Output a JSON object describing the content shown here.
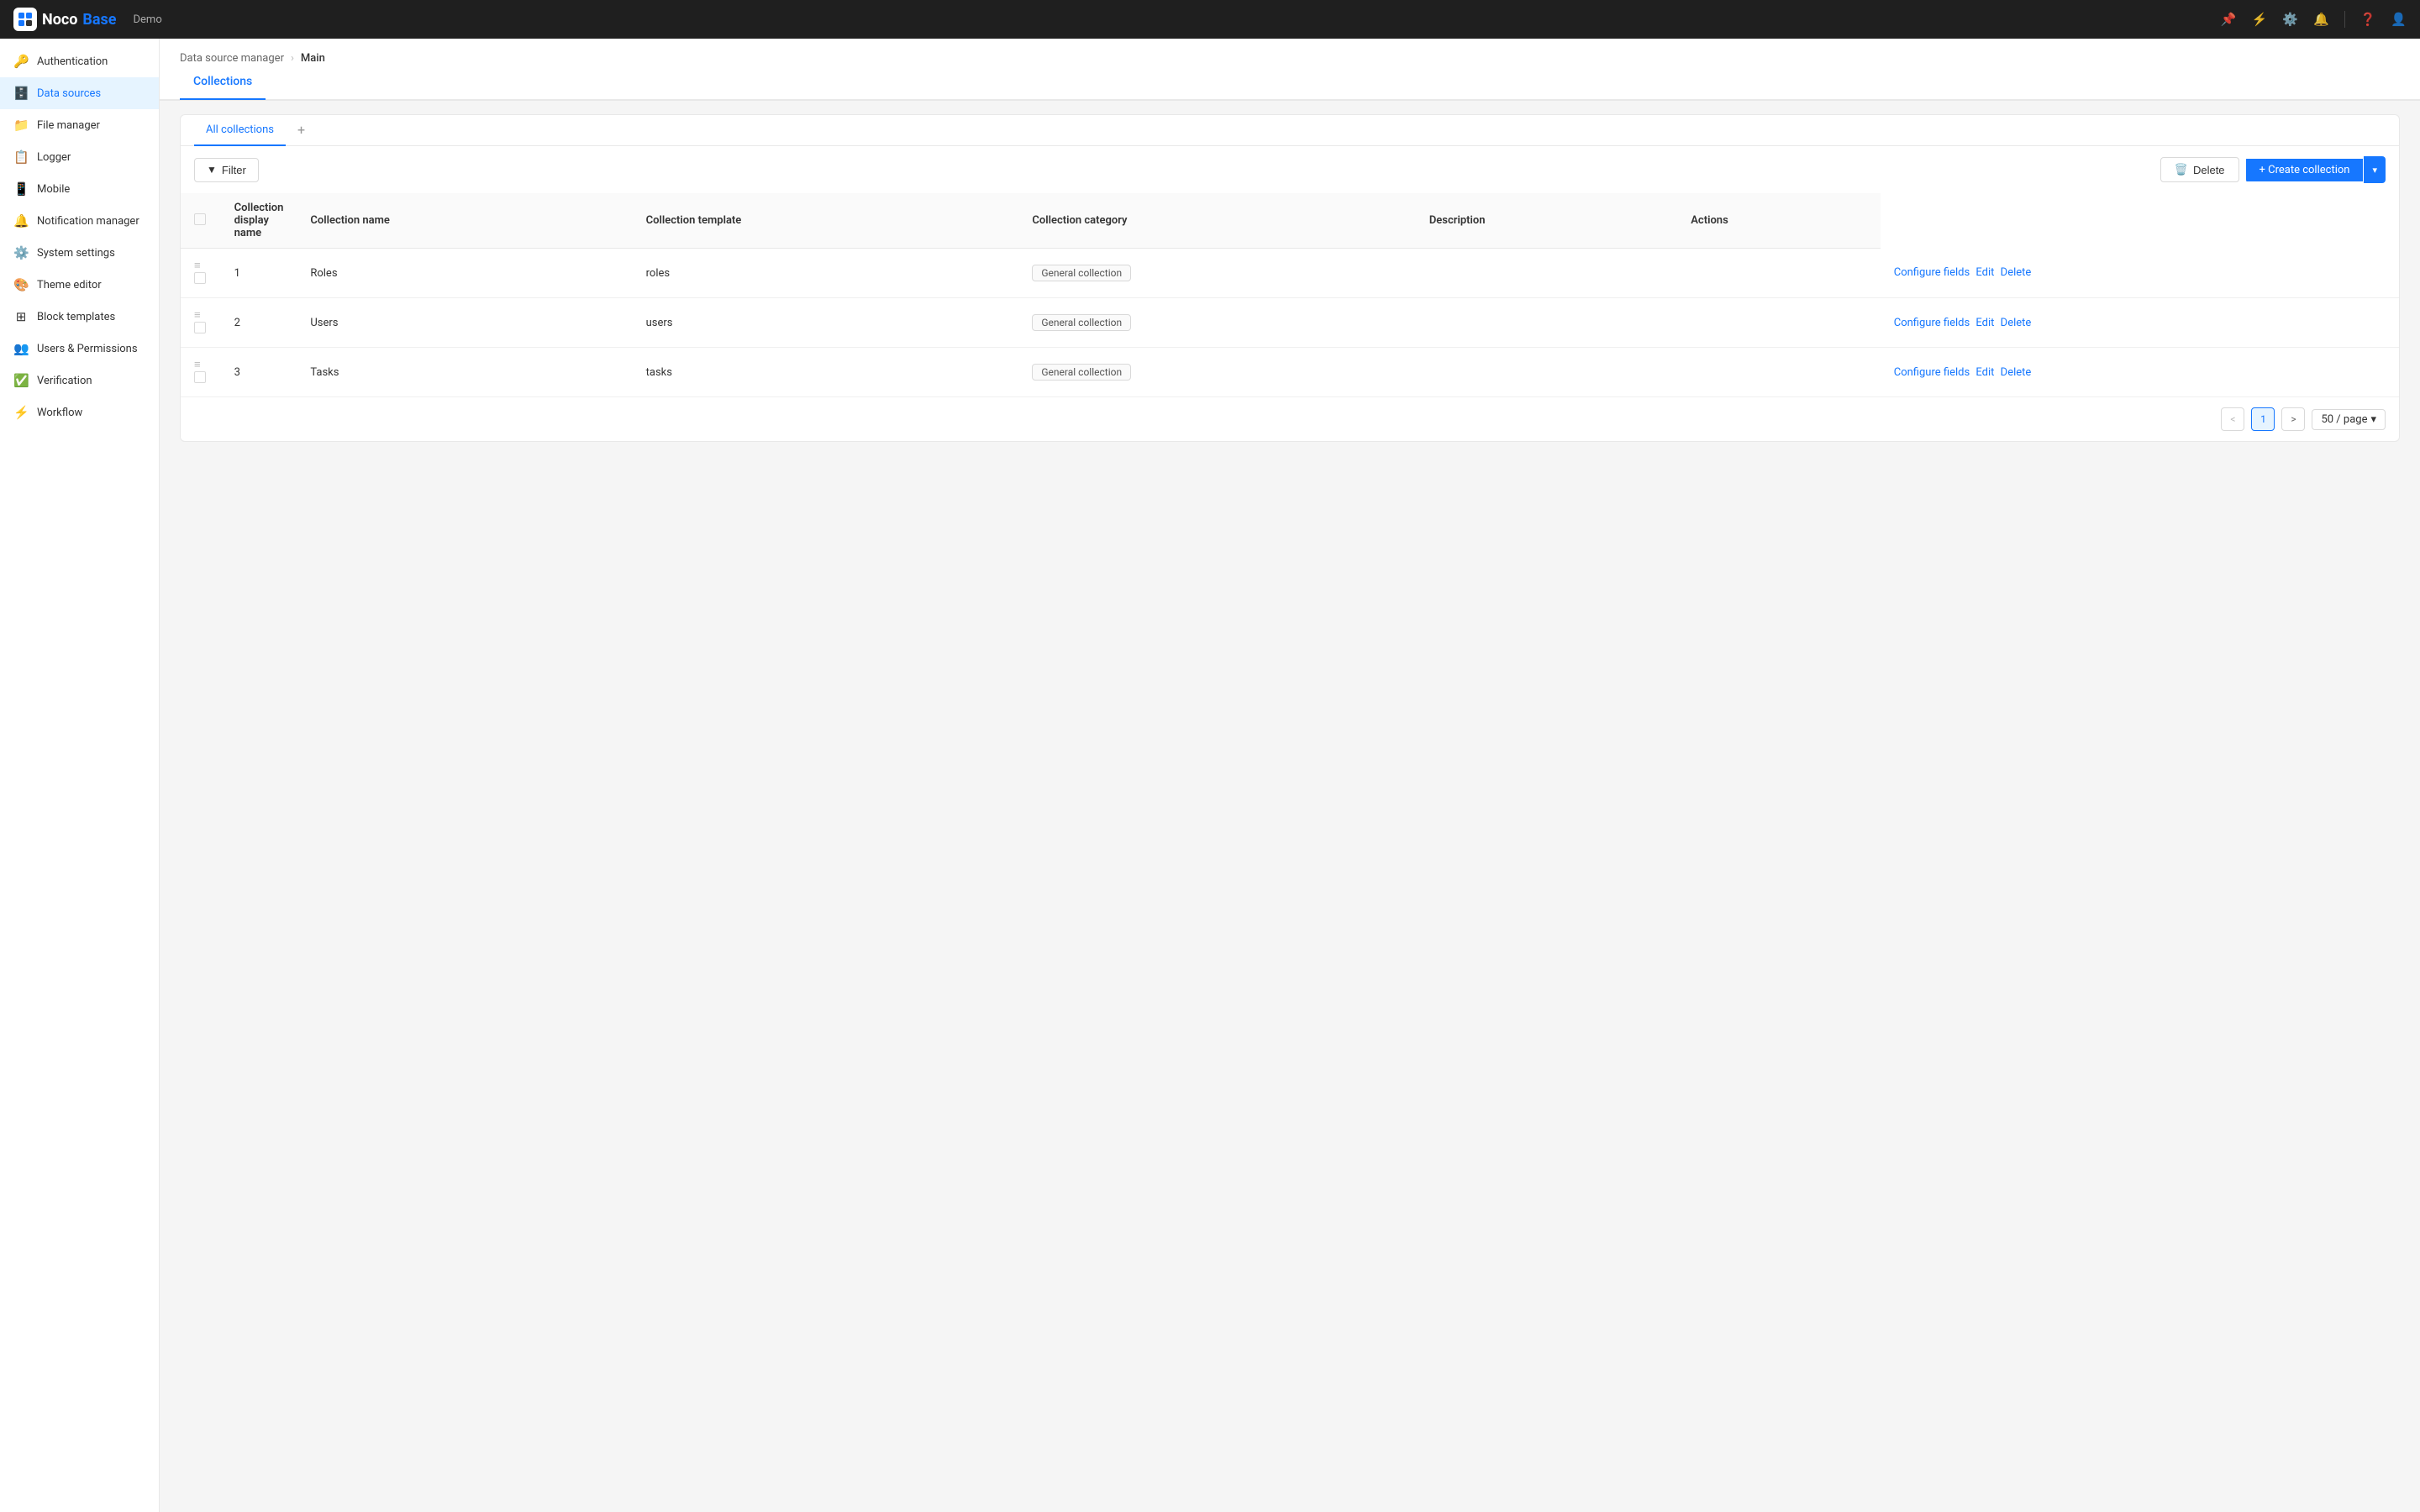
{
  "app": {
    "logo_text_noco": "Noco",
    "logo_text_base": "Base",
    "demo_label": "Demo"
  },
  "topnav": {
    "icons": [
      {
        "name": "pin-icon",
        "symbol": "📌"
      },
      {
        "name": "bolt-icon",
        "symbol": "⚡"
      },
      {
        "name": "settings-icon",
        "symbol": "⚙️"
      },
      {
        "name": "bell-icon",
        "symbol": "🔔"
      },
      {
        "name": "help-icon",
        "symbol": "❓"
      },
      {
        "name": "user-icon",
        "symbol": "👤"
      }
    ]
  },
  "sidebar": {
    "items": [
      {
        "id": "authentication",
        "label": "Authentication",
        "icon": "🔑",
        "active": false
      },
      {
        "id": "data-sources",
        "label": "Data sources",
        "icon": "🗄️",
        "active": true
      },
      {
        "id": "file-manager",
        "label": "File manager",
        "icon": "📁",
        "active": false
      },
      {
        "id": "logger",
        "label": "Logger",
        "icon": "📋",
        "active": false
      },
      {
        "id": "mobile",
        "label": "Mobile",
        "icon": "📱",
        "active": false
      },
      {
        "id": "notification-manager",
        "label": "Notification manager",
        "icon": "🔔",
        "active": false
      },
      {
        "id": "system-settings",
        "label": "System settings",
        "icon": "⚙️",
        "active": false
      },
      {
        "id": "theme-editor",
        "label": "Theme editor",
        "icon": "🎨",
        "active": false
      },
      {
        "id": "block-templates",
        "label": "Block templates",
        "icon": "⊞",
        "active": false
      },
      {
        "id": "users-permissions",
        "label": "Users & Permissions",
        "icon": "👥",
        "active": false
      },
      {
        "id": "verification",
        "label": "Verification",
        "icon": "✅",
        "active": false
      },
      {
        "id": "workflow",
        "label": "Workflow",
        "icon": "⚡",
        "active": false
      }
    ]
  },
  "breadcrumb": {
    "parent": "Data source manager",
    "current": "Main"
  },
  "tabs": [
    {
      "id": "collections",
      "label": "Collections",
      "active": true
    }
  ],
  "collection_tabs": {
    "all_collections_label": "All collections",
    "add_label": "+"
  },
  "toolbar": {
    "filter_label": "Filter",
    "delete_label": "Delete",
    "create_label": "+ Create collection",
    "dropdown_arrow": "▾"
  },
  "table": {
    "columns": [
      {
        "id": "display_name",
        "label": "Collection display name"
      },
      {
        "id": "name",
        "label": "Collection name"
      },
      {
        "id": "template",
        "label": "Collection template"
      },
      {
        "id": "category",
        "label": "Collection category"
      },
      {
        "id": "description",
        "label": "Description"
      },
      {
        "id": "actions",
        "label": "Actions"
      }
    ],
    "rows": [
      {
        "num": "1",
        "display_name": "Roles",
        "name": "roles",
        "template": "General collection",
        "category": "",
        "description": "",
        "configure_fields": "Configure fields",
        "edit": "Edit",
        "delete": "Delete"
      },
      {
        "num": "2",
        "display_name": "Users",
        "name": "users",
        "template": "General collection",
        "category": "",
        "description": "",
        "configure_fields": "Configure fields",
        "edit": "Edit",
        "delete": "Delete"
      },
      {
        "num": "3",
        "display_name": "Tasks",
        "name": "tasks",
        "template": "General collection",
        "category": "",
        "description": "",
        "configure_fields": "Configure fields",
        "edit": "Edit",
        "delete": "Delete"
      }
    ]
  },
  "pagination": {
    "prev": "<",
    "next": ">",
    "current_page": "1",
    "page_size": "50 / page",
    "dropdown_arrow": "▾"
  }
}
